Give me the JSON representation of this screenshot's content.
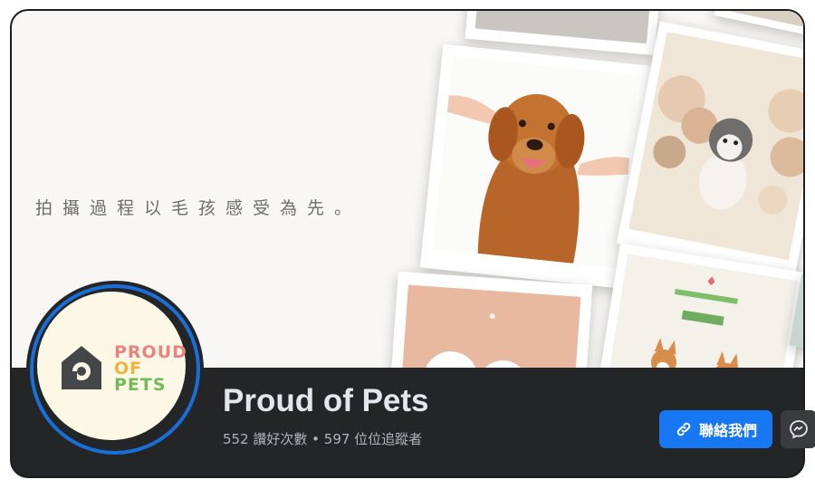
{
  "cover": {
    "tagline": "拍攝過程以毛孩感受為先。"
  },
  "profile": {
    "logo_lines": [
      "PROUD",
      "OF",
      "PETS"
    ],
    "page_name": "Proud of Pets",
    "stats": "552 讚好次數 • 597 位位追蹤者"
  },
  "actions": {
    "contact_label": "聯絡我們",
    "contact_icon": "link-icon",
    "messenger_icon": "messenger-icon"
  },
  "colors": {
    "accent": "#1877f2",
    "ring": "#1a6ed8",
    "bar_bg": "#242526",
    "logo_pink": "#e8837f",
    "logo_orange": "#f0b23c",
    "logo_green": "#76b95a"
  }
}
